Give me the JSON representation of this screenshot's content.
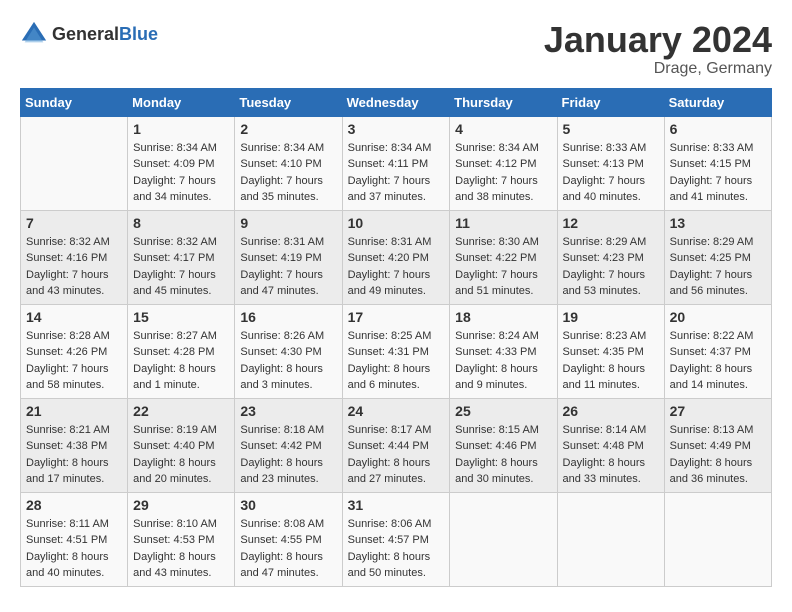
{
  "header": {
    "logo_general": "General",
    "logo_blue": "Blue",
    "month": "January 2024",
    "location": "Drage, Germany"
  },
  "days_of_week": [
    "Sunday",
    "Monday",
    "Tuesday",
    "Wednesday",
    "Thursday",
    "Friday",
    "Saturday"
  ],
  "weeks": [
    [
      {
        "day": "",
        "sunrise": "",
        "sunset": "",
        "daylight": ""
      },
      {
        "day": "1",
        "sunrise": "Sunrise: 8:34 AM",
        "sunset": "Sunset: 4:09 PM",
        "daylight": "Daylight: 7 hours and 34 minutes."
      },
      {
        "day": "2",
        "sunrise": "Sunrise: 8:34 AM",
        "sunset": "Sunset: 4:10 PM",
        "daylight": "Daylight: 7 hours and 35 minutes."
      },
      {
        "day": "3",
        "sunrise": "Sunrise: 8:34 AM",
        "sunset": "Sunset: 4:11 PM",
        "daylight": "Daylight: 7 hours and 37 minutes."
      },
      {
        "day": "4",
        "sunrise": "Sunrise: 8:34 AM",
        "sunset": "Sunset: 4:12 PM",
        "daylight": "Daylight: 7 hours and 38 minutes."
      },
      {
        "day": "5",
        "sunrise": "Sunrise: 8:33 AM",
        "sunset": "Sunset: 4:13 PM",
        "daylight": "Daylight: 7 hours and 40 minutes."
      },
      {
        "day": "6",
        "sunrise": "Sunrise: 8:33 AM",
        "sunset": "Sunset: 4:15 PM",
        "daylight": "Daylight: 7 hours and 41 minutes."
      }
    ],
    [
      {
        "day": "7",
        "sunrise": "Sunrise: 8:32 AM",
        "sunset": "Sunset: 4:16 PM",
        "daylight": "Daylight: 7 hours and 43 minutes."
      },
      {
        "day": "8",
        "sunrise": "Sunrise: 8:32 AM",
        "sunset": "Sunset: 4:17 PM",
        "daylight": "Daylight: 7 hours and 45 minutes."
      },
      {
        "day": "9",
        "sunrise": "Sunrise: 8:31 AM",
        "sunset": "Sunset: 4:19 PM",
        "daylight": "Daylight: 7 hours and 47 minutes."
      },
      {
        "day": "10",
        "sunrise": "Sunrise: 8:31 AM",
        "sunset": "Sunset: 4:20 PM",
        "daylight": "Daylight: 7 hours and 49 minutes."
      },
      {
        "day": "11",
        "sunrise": "Sunrise: 8:30 AM",
        "sunset": "Sunset: 4:22 PM",
        "daylight": "Daylight: 7 hours and 51 minutes."
      },
      {
        "day": "12",
        "sunrise": "Sunrise: 8:29 AM",
        "sunset": "Sunset: 4:23 PM",
        "daylight": "Daylight: 7 hours and 53 minutes."
      },
      {
        "day": "13",
        "sunrise": "Sunrise: 8:29 AM",
        "sunset": "Sunset: 4:25 PM",
        "daylight": "Daylight: 7 hours and 56 minutes."
      }
    ],
    [
      {
        "day": "14",
        "sunrise": "Sunrise: 8:28 AM",
        "sunset": "Sunset: 4:26 PM",
        "daylight": "Daylight: 7 hours and 58 minutes."
      },
      {
        "day": "15",
        "sunrise": "Sunrise: 8:27 AM",
        "sunset": "Sunset: 4:28 PM",
        "daylight": "Daylight: 8 hours and 1 minute."
      },
      {
        "day": "16",
        "sunrise": "Sunrise: 8:26 AM",
        "sunset": "Sunset: 4:30 PM",
        "daylight": "Daylight: 8 hours and 3 minutes."
      },
      {
        "day": "17",
        "sunrise": "Sunrise: 8:25 AM",
        "sunset": "Sunset: 4:31 PM",
        "daylight": "Daylight: 8 hours and 6 minutes."
      },
      {
        "day": "18",
        "sunrise": "Sunrise: 8:24 AM",
        "sunset": "Sunset: 4:33 PM",
        "daylight": "Daylight: 8 hours and 9 minutes."
      },
      {
        "day": "19",
        "sunrise": "Sunrise: 8:23 AM",
        "sunset": "Sunset: 4:35 PM",
        "daylight": "Daylight: 8 hours and 11 minutes."
      },
      {
        "day": "20",
        "sunrise": "Sunrise: 8:22 AM",
        "sunset": "Sunset: 4:37 PM",
        "daylight": "Daylight: 8 hours and 14 minutes."
      }
    ],
    [
      {
        "day": "21",
        "sunrise": "Sunrise: 8:21 AM",
        "sunset": "Sunset: 4:38 PM",
        "daylight": "Daylight: 8 hours and 17 minutes."
      },
      {
        "day": "22",
        "sunrise": "Sunrise: 8:19 AM",
        "sunset": "Sunset: 4:40 PM",
        "daylight": "Daylight: 8 hours and 20 minutes."
      },
      {
        "day": "23",
        "sunrise": "Sunrise: 8:18 AM",
        "sunset": "Sunset: 4:42 PM",
        "daylight": "Daylight: 8 hours and 23 minutes."
      },
      {
        "day": "24",
        "sunrise": "Sunrise: 8:17 AM",
        "sunset": "Sunset: 4:44 PM",
        "daylight": "Daylight: 8 hours and 27 minutes."
      },
      {
        "day": "25",
        "sunrise": "Sunrise: 8:15 AM",
        "sunset": "Sunset: 4:46 PM",
        "daylight": "Daylight: 8 hours and 30 minutes."
      },
      {
        "day": "26",
        "sunrise": "Sunrise: 8:14 AM",
        "sunset": "Sunset: 4:48 PM",
        "daylight": "Daylight: 8 hours and 33 minutes."
      },
      {
        "day": "27",
        "sunrise": "Sunrise: 8:13 AM",
        "sunset": "Sunset: 4:49 PM",
        "daylight": "Daylight: 8 hours and 36 minutes."
      }
    ],
    [
      {
        "day": "28",
        "sunrise": "Sunrise: 8:11 AM",
        "sunset": "Sunset: 4:51 PM",
        "daylight": "Daylight: 8 hours and 40 minutes."
      },
      {
        "day": "29",
        "sunrise": "Sunrise: 8:10 AM",
        "sunset": "Sunset: 4:53 PM",
        "daylight": "Daylight: 8 hours and 43 minutes."
      },
      {
        "day": "30",
        "sunrise": "Sunrise: 8:08 AM",
        "sunset": "Sunset: 4:55 PM",
        "daylight": "Daylight: 8 hours and 47 minutes."
      },
      {
        "day": "31",
        "sunrise": "Sunrise: 8:06 AM",
        "sunset": "Sunset: 4:57 PM",
        "daylight": "Daylight: 8 hours and 50 minutes."
      },
      {
        "day": "",
        "sunrise": "",
        "sunset": "",
        "daylight": ""
      },
      {
        "day": "",
        "sunrise": "",
        "sunset": "",
        "daylight": ""
      },
      {
        "day": "",
        "sunrise": "",
        "sunset": "",
        "daylight": ""
      }
    ]
  ]
}
